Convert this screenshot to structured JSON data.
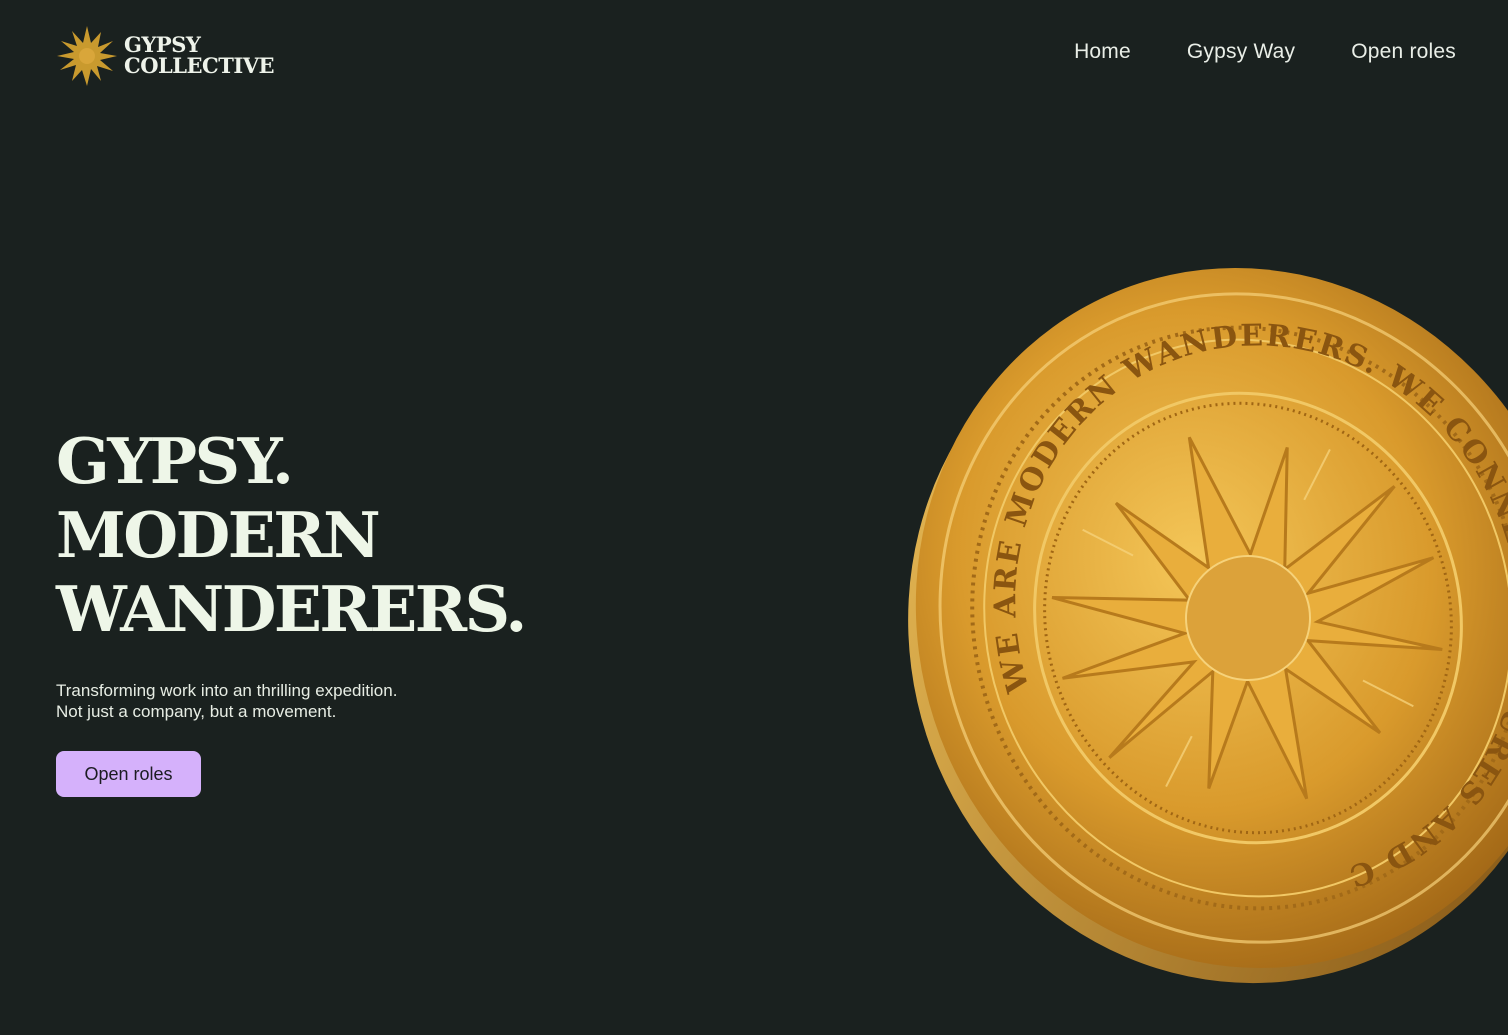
{
  "brand": {
    "name_line1": "GYPSY",
    "name_line2": "COLLECTIVE",
    "logo_icon": "starburst-icon"
  },
  "nav": {
    "items": [
      {
        "label": "Home"
      },
      {
        "label": "Gypsy Way"
      },
      {
        "label": "Open roles"
      }
    ]
  },
  "hero": {
    "title_lines": [
      "GYPSY.",
      "MODERN",
      "WANDERERS."
    ],
    "subtitle_lines": [
      "Transforming work into an thrilling expedition.",
      "Not just a company, but a movement."
    ],
    "cta_label": "Open roles"
  },
  "coin": {
    "inscription_outer": "WE ARE MODERN WANDERERS. WE CONNECT CULTURES AND CREATE PLAY."
  },
  "colors": {
    "background": "#1a211f",
    "text": "#eef3ea",
    "accent_button": "#d5b1fb",
    "gold": "#d9a23a",
    "logo_gold": "#c99a2e"
  }
}
